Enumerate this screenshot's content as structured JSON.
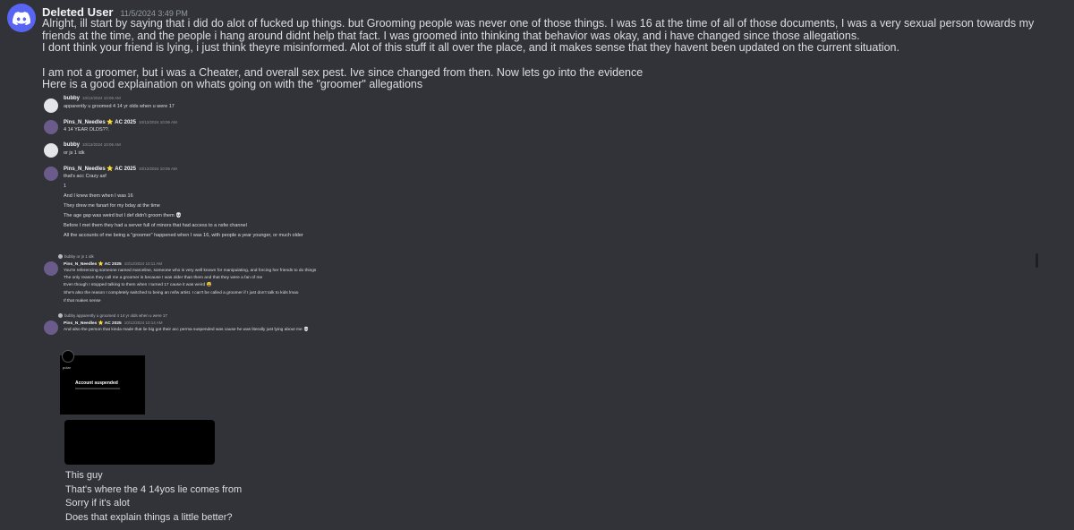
{
  "message": {
    "author": "Deleted User",
    "timestamp": "11/5/2024 3:49 PM",
    "paragraphs": [
      "Alright, ill start by saying that i did do alot of fucked up things. but Grooming people was never one of those things. I was 16 at the time of all of those documents, I was a very sexual person towards my friends at the time, and the people i hang around didnt help that fact. I was groomed into thinking that behavior was okay, and i have changed since those allegations.",
      "I dont think your friend is lying, i just think theyre misinformed. Alot of this stuff it all over the place, and it makes sense that they havent been updated on the current situation.",
      "",
      "I am not a groomer, but i was a Cheater, and overall sex pest. Ive since changed from then. Now lets go into the evidence",
      "Here is a good explaination on whats going on with the \"groomer\" allegations"
    ],
    "colors": {
      "bg": "#313338",
      "brand": "#5865f2"
    }
  },
  "screenshot1": {
    "messages": [
      {
        "author": "bubby",
        "ts": "10/12/2024 10:06 AM",
        "lines": [
          "apparently u groomed 4 14 yr olds when u were 17"
        ]
      },
      {
        "author": "Pins_N_Needles ⭐ AC 2025",
        "ts": "10/12/2024 10:06 AM",
        "lines": [
          "4 14 YEAR OLDS??."
        ]
      },
      {
        "author": "bubby",
        "ts": "10/12/2024 10:06 AM",
        "lines": [
          "or js 1 idk"
        ]
      },
      {
        "author": "Pins_N_Needles ⭐ AC 2025",
        "ts": "10/12/2024 10:06 AM",
        "lines": [
          "that's acc Crazy asf",
          "1",
          "And I knew them when I was 16",
          "They drew me fanart for my bday at the time",
          "The age gap was weird but I def didn't groom them 💀",
          "Before I met them they had a server full of minors that had access to a nsfw channel",
          "All the accounts of me being a \"groomer\" happened when I was 16, with people a year younger, or much older"
        ]
      }
    ]
  },
  "screenshot2": {
    "reply1": "bubby or js 1 idk",
    "msg1": {
      "author": "Pins_N_Needles ⭐ AC 2025",
      "ts": "10/12/2024 10:11 AM",
      "lines": [
        "You're referencing someone named marceline, someone who is very well known for manipulating, and forcing her friends to do things",
        "The only reason they call me a groomer is because I was older than them and that they were a fan of me",
        "Even though I stopped talking to them when I turned 17 cause it was weird 😅",
        "She's also the reason I completely switched to being an nsfw artist. I can't be called a groomer if I just don't talk to kids lmao",
        "If that makes sense"
      ]
    },
    "reply2": "bubby apparently u groomed 4 14 yr olds when u were 17",
    "msg2": {
      "author": "Pins_N_Needles ⭐ AC 2025",
      "ts": "10/12/2024 10:14 AM",
      "lines": [
        "And also the person that kinda made that lie big got their acc perma suspended was cause he was literally just lying about me 💀"
      ]
    }
  },
  "embed": {
    "name": "polar",
    "title": "Account suspended"
  },
  "closing_lines": [
    "This guy",
    "That's where the 4 14yos lie comes from",
    "Sorry if it's alot",
    "Does that explain things a little better?"
  ]
}
